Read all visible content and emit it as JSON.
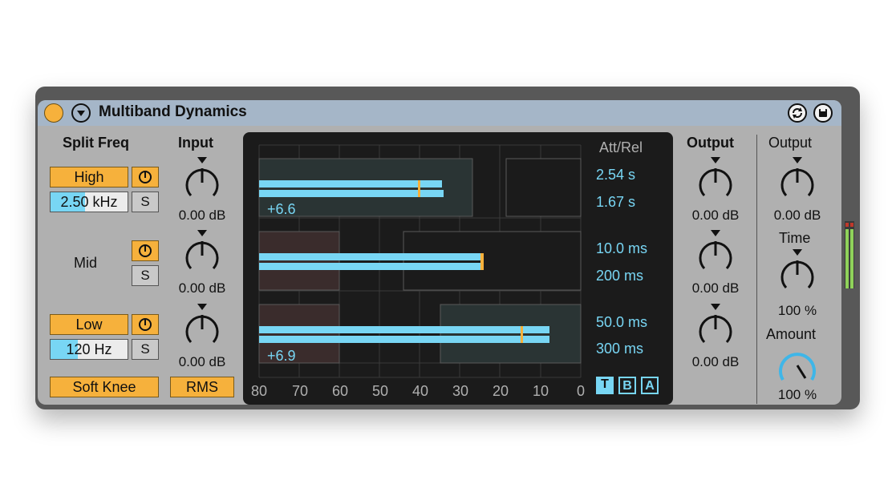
{
  "device": {
    "title": "Multiband Dynamics",
    "icons": [
      "power-icon",
      "collapse-icon",
      "hot-swap-icon",
      "save-preset-icon"
    ]
  },
  "split_freq": {
    "header": "Split Freq",
    "high": {
      "label": "High",
      "value": "2.50",
      "unit": "kHz",
      "solo": "S",
      "activator_fill": 0.45
    },
    "mid": {
      "label": "Mid",
      "solo": "S"
    },
    "low": {
      "label": "Low",
      "value": "120",
      "unit": "Hz",
      "solo": "S",
      "activator_fill": 0.35
    }
  },
  "input": {
    "header": "Input",
    "knobs": [
      "0.00 dB",
      "0.00 dB",
      "0.00 dB"
    ]
  },
  "buttons": {
    "soft_knee": "Soft Knee",
    "rms": "RMS"
  },
  "display": {
    "x_ticks": [
      "80",
      "70",
      "60",
      "50",
      "40",
      "30",
      "20",
      "10",
      "0"
    ],
    "att_rel_header": "Att/Rel",
    "bands": [
      {
        "attack": "2.54 s",
        "release": "1.67 s",
        "gain_readout": "+6.6"
      },
      {
        "attack": "10.0 ms",
        "release": "200 ms",
        "gain_readout": ""
      },
      {
        "attack": "50.0 ms",
        "release": "300 ms",
        "gain_readout": "+6.9"
      }
    ],
    "view_buttons": [
      "T",
      "B",
      "A"
    ],
    "view_selected": "T"
  },
  "output": {
    "header": "Output",
    "knobs": [
      "0.00 dB",
      "0.00 dB",
      "0.00 dB"
    ]
  },
  "global": {
    "output_header": "Output",
    "output_value": "0.00 dB",
    "time_header": "Time",
    "time_value": "100 %",
    "amount_header": "Amount",
    "amount_value": "100 %"
  },
  "colors": {
    "accent_yellow": "#f6b13c",
    "meter_cyan": "#78d6f4",
    "amount_blue": "#3fb6e8",
    "title_bar": "#a5b6c8"
  }
}
